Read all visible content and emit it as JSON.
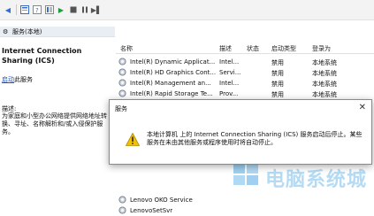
{
  "left_panel": {
    "header_label": "服务(本地)",
    "service_name": "Internet Connection Sharing (ICS)",
    "start_link": "启动",
    "start_suffix": "此服务",
    "description_label": "描述:",
    "description_text": "为家庭和小型办公网络提供网络地址转换、寻址、名称解析和/或入侵保护服务。"
  },
  "table": {
    "columns": [
      "名称",
      "描述",
      "状态",
      "启动类型",
      "登录为"
    ],
    "rows": [
      {
        "name": "Intel(R) Dynamic Applicat...",
        "desc": "Intel...",
        "status": "",
        "startup": "禁用",
        "logon": "本地系统"
      },
      {
        "name": "Intel(R) HD Graphics Cont...",
        "desc": "Servi...",
        "status": "",
        "startup": "禁用",
        "logon": "本地系统"
      },
      {
        "name": "Intel(R) Management an...",
        "desc": "Intel...",
        "status": "",
        "startup": "禁用",
        "logon": "本地系统"
      },
      {
        "name": "Intel(R) Rapid Storage Te...",
        "desc": "Prov...",
        "status": "",
        "startup": "禁用",
        "logon": "本地系统"
      },
      {
        "name": "Lenovo OKO Service",
        "desc": "",
        "status": "",
        "startup": "",
        "logon": ""
      },
      {
        "name": "LenovoSetSvr",
        "desc": "",
        "status": "",
        "startup": "",
        "logon": ""
      }
    ]
  },
  "dialog": {
    "title": "服务",
    "message": "本地计算机 上的 Internet Connection Sharing (ICS) 服务启动后停止。某些服务在未由其他服务或程序使用时将自动停止。",
    "close_glyph": "✕",
    "warning_icon": "warning-icon"
  },
  "watermark": {
    "text": "电脑系统城"
  },
  "colors": {
    "link": "#1a55c7",
    "play": "#1e9b3a",
    "warning": "#f2c200"
  }
}
